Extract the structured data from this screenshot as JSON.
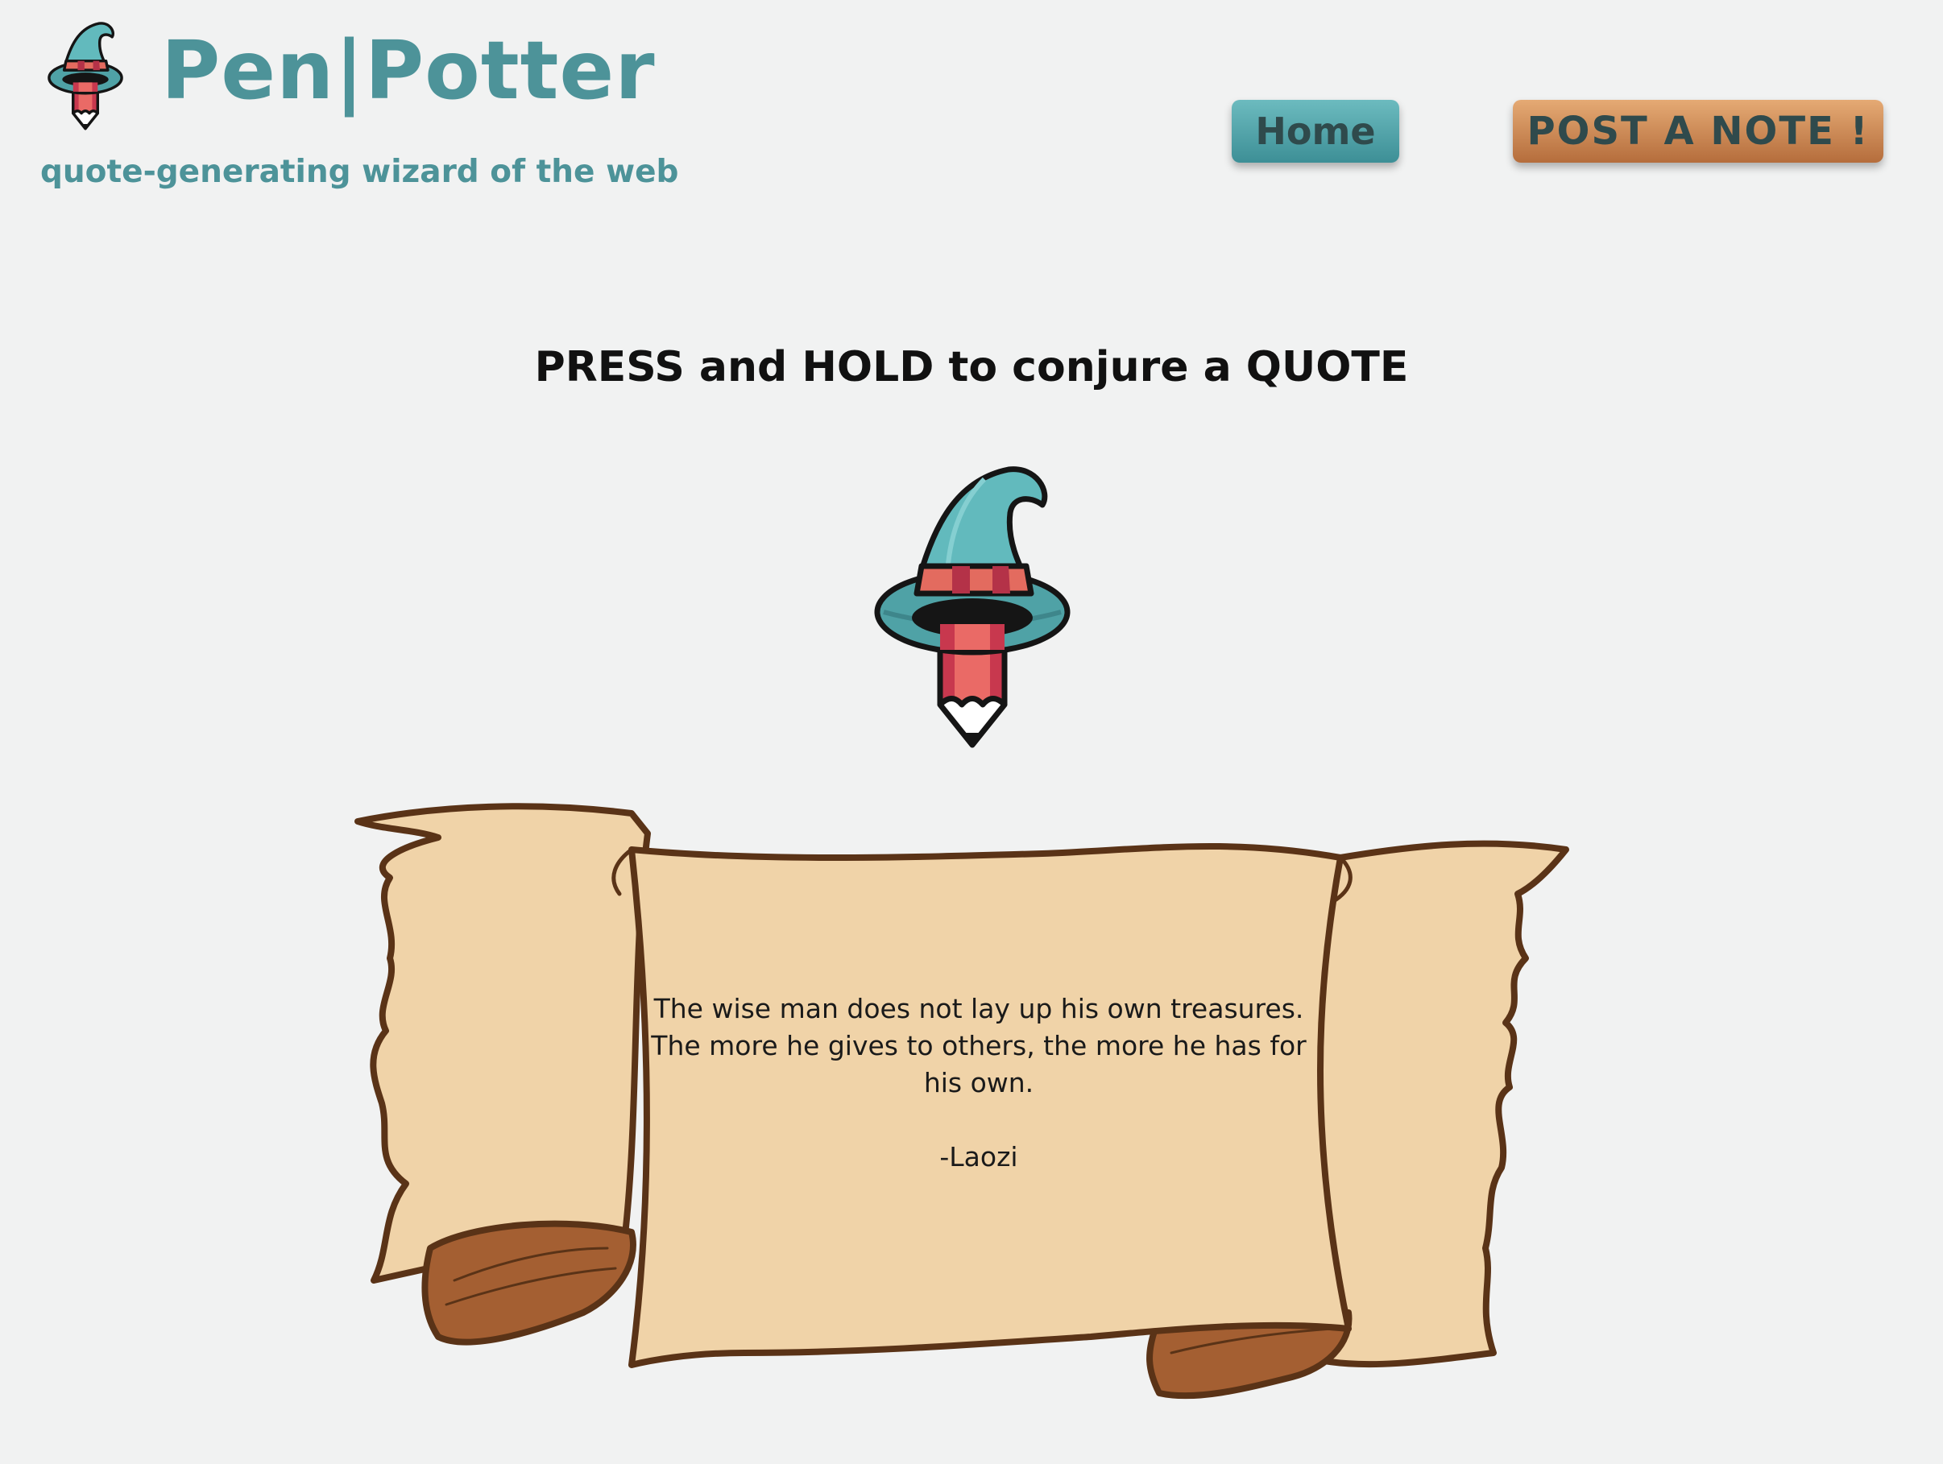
{
  "header": {
    "title": "Pen|Potter",
    "tagline": "quote-generating wizard of the web",
    "logo_icon": "wizard-pencil-icon"
  },
  "nav": {
    "home_label": "Home",
    "post_label": "POST A NOTE !"
  },
  "main": {
    "prompt": "PRESS and HOLD to conjure a QUOTE",
    "wizard_icon": "wizard-pencil-icon",
    "quote": {
      "text": "The wise man does not lay up his own treasures. The more he gives to others, the more he has for his own.",
      "author": "-Laozi"
    }
  },
  "colors": {
    "background": "#f1f2f2",
    "brand_teal": "#4d9399",
    "home_button": "#53a5aa",
    "post_button": "#d08a55",
    "parchment": "#f0d3a8",
    "scroll_outline": "#5a3317"
  }
}
